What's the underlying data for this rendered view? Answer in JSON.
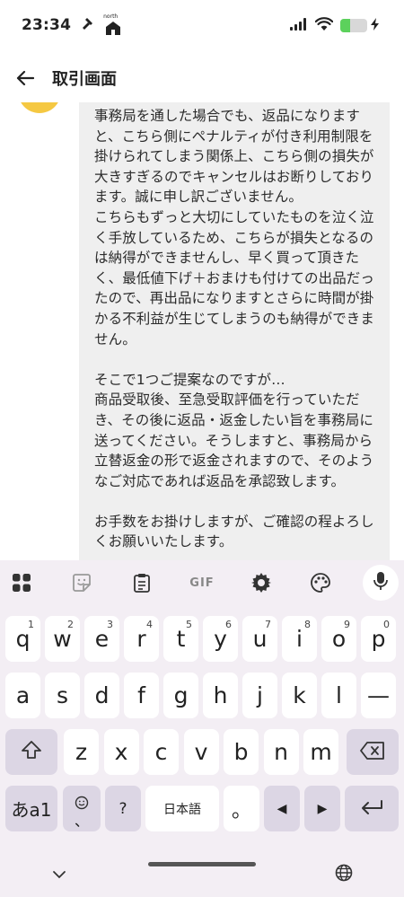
{
  "status_bar": {
    "time": "23:34",
    "notification_label": "north",
    "battery_percent": 35,
    "battery_color": "#5cd15c"
  },
  "header": {
    "title": "取引画面"
  },
  "message": {
    "avatar_color": "#f5c842",
    "bubble_color": "#efefef",
    "paragraphs": [
      "事務局を通した場合でも、返品になりますと、こちら側にペナルティが付き利用制限を掛けられてしまう関係上、こちら側の損失が大きすぎるのでキャンセルはお断りしております。誠に申し訳ございません。\nこちらもずっと大切にしていたものを泣く泣く手放しているため、こちらが損失となるのは納得ができませんし、早く買って頂きたく、最低値下げ＋おまけも付けての出品だったので、再出品になりますとさらに時間が掛かる不利益が生じてしまうのも納得ができません。",
      "そこで1つご提案なのですが…\n商品受取後、至急受取評価を行っていただき、その後に返品・返金したい旨を事務局に送ってください。そうしますと、事務局から立替返金の形で返金されますので、そのようなご対応であれば返品を承認致します。",
      "お手数をお掛けしますが、ご確認の程よろしくお願いいたします。"
    ]
  },
  "keyboard": {
    "toolbar": {
      "gif_label": "GIF"
    },
    "row1": [
      {
        "key": "q",
        "hint": "1"
      },
      {
        "key": "w",
        "hint": "2"
      },
      {
        "key": "e",
        "hint": "3"
      },
      {
        "key": "r",
        "hint": "4"
      },
      {
        "key": "t",
        "hint": "5"
      },
      {
        "key": "y",
        "hint": "6"
      },
      {
        "key": "u",
        "hint": "7"
      },
      {
        "key": "i",
        "hint": "8"
      },
      {
        "key": "o",
        "hint": "9"
      },
      {
        "key": "p",
        "hint": "0"
      }
    ],
    "row2": [
      "a",
      "s",
      "d",
      "f",
      "g",
      "h",
      "j",
      "k",
      "l",
      "—"
    ],
    "row3": [
      "z",
      "x",
      "c",
      "v",
      "b",
      "n",
      "m"
    ],
    "row4": {
      "mode_key": "あa1",
      "punct_key": "、",
      "question_key": "?",
      "space_key": "日本語",
      "period_key": "。",
      "left_arrow": "◀",
      "right_arrow": "▶"
    },
    "accent_color": "#dcd6e4",
    "background_color": "#f3eef4"
  }
}
